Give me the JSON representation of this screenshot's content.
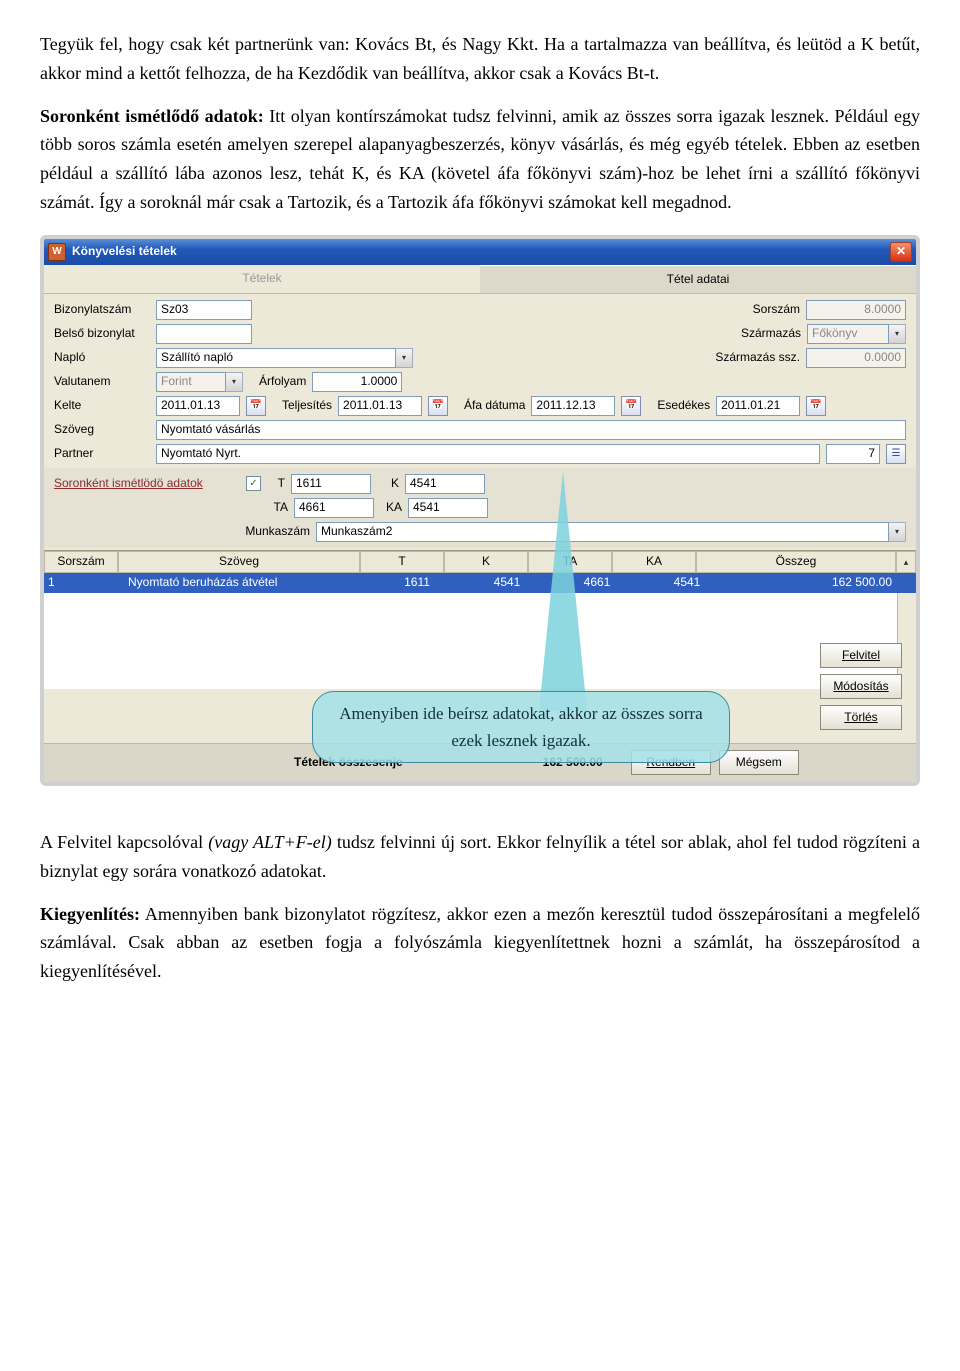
{
  "para1": "Tegyük fel, hogy csak két partnerünk van: Kovács Bt, és Nagy Kkt. Ha a tartalmazza van beállítva, és leütöd a K betűt, akkor mind a kettőt felhozza, de ha Kezdődik van beállítva, akkor csak a Kovács Bt-t.",
  "para2_lead": "Soronként ismétlődő adatok:",
  "para2_rest": " Itt olyan kontírszámokat tudsz felvinni, amik az összes sorra igazak lesznek. Például egy több soros számla esetén amelyen szerepel alapanyagbeszerzés, könyv vásárlás, és még egyéb tételek. Ebben az esetben például a szállító lába azonos lesz, tehát K, és KA (követel áfa főkönyvi szám)-hoz be lehet írni a szállító főkönyvi számát. Így a soroknál már csak a Tartozik, és a Tartozik áfa főkönyvi számokat kell megadnod.",
  "para3_a": "A Felvitel kapcsolóval ",
  "para3_i": "(vagy ALT+F-el)",
  "para3_b": " tudsz felvinni új sort. Ekkor felnyílik a tétel sor ablak, ahol fel tudod rögzíteni a biznylat egy sorára vonatkozó adatokat.",
  "para4_lead": "Kiegyenlítés:",
  "para4_rest": " Amennyiben bank bizonylatot rögzítesz, akkor ezen a mezőn keresztül tudod összepárosítani a megfelelő számlával. Csak abban az esetben fogja a folyószámla kiegyenlítettnek hozni a számlát, ha összepárosítod a kiegyenlítésével.",
  "win": {
    "title": "Könyvelési tételek",
    "tabs": {
      "left": "Tételek",
      "right": "Tétel adatai"
    },
    "labels": {
      "bizszam": "Bizonylatszám",
      "belso": "Belső bizonylat",
      "naplo": "Napló",
      "valutanem": "Valutanem",
      "arfolyam": "Árfolyam",
      "kelte": "Kelte",
      "teljesites": "Teljesítés",
      "afadatum": "Áfa dátuma",
      "esedekes": "Esedékes",
      "szoveg": "Szöveg",
      "partner": "Partner",
      "sorszam": "Sorszám",
      "szarmazas": "Származás",
      "szarmazasssz": "Származás ssz.",
      "repeat": "Soronként ismétlödö adatok",
      "T": "T",
      "K": "K",
      "TA": "TA",
      "KA": "KA",
      "munkaszam": "Munkaszám"
    },
    "vals": {
      "bizszam": "Sz03",
      "naplo": "Szállító napló",
      "valutanem": "Forint",
      "arfolyam": "1.0000",
      "kelte": "2011.01.13",
      "teljesites": "2011.01.13",
      "afadatum": "2011.12.13",
      "esedekes": "2011.01.21",
      "szoveg": "Nyomtató vásárlás",
      "partner": "Nyomtató Nyrt.",
      "partnerid": "7",
      "sorszam": "8.0000",
      "szarmazas": "Főkönyv",
      "szarmazasssz": "0.0000",
      "T": "1611",
      "K": "4541",
      "TA": "4661",
      "KA": "4541",
      "munkaszam": "Munkaszám2"
    },
    "grid": {
      "h": {
        "sorszam": "Sorszám",
        "szoveg": "Szöveg",
        "T": "T",
        "K": "K",
        "TA": "TA",
        "KA": "KA",
        "osszeg": "Összeg"
      },
      "row": {
        "sorszam": "1",
        "szoveg": "Nyomtató beruházás átvétel",
        "T": "1611",
        "K": "4541",
        "TA": "4661",
        "KA": "4541",
        "osszeg": "162 500.00"
      }
    },
    "callout": "Amenyiben ide beírsz adatokat, akkor az összes sorra ezek lesznek igazak.",
    "btns": {
      "felvitel": "Felvitel",
      "modositas": "Módosítás",
      "torles": "Törlés",
      "rendben": "Rendben",
      "megsem": "Mégsem"
    },
    "footer": {
      "label": "Tételek összesenje",
      "value": "162 500.00"
    }
  }
}
